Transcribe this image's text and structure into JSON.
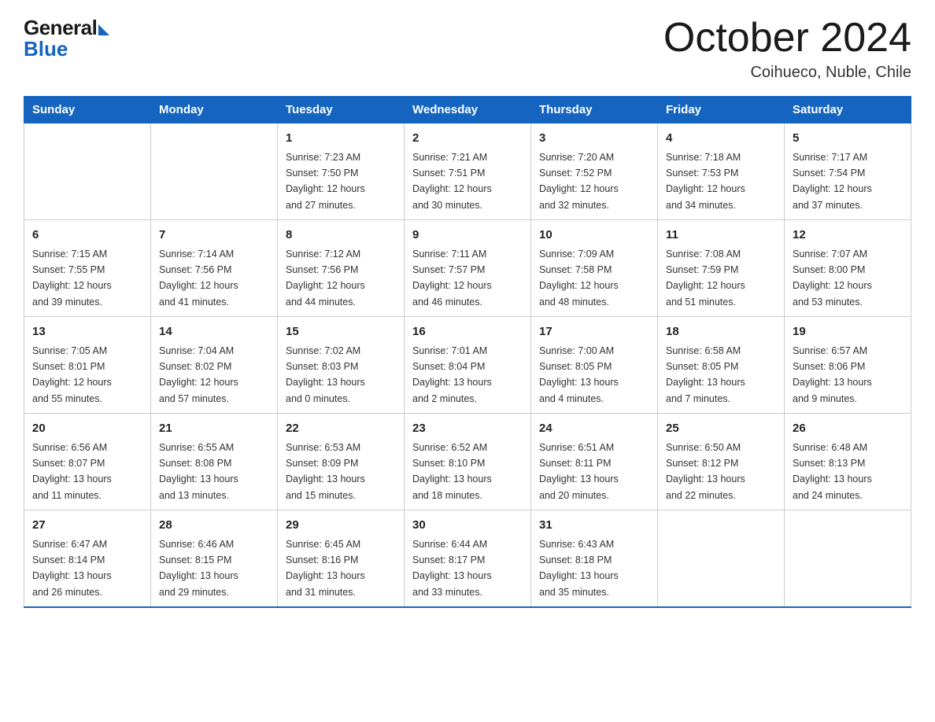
{
  "header": {
    "logo_general": "General",
    "logo_blue": "Blue",
    "month_title": "October 2024",
    "subtitle": "Coihueco, Nuble, Chile"
  },
  "days_of_week": [
    "Sunday",
    "Monday",
    "Tuesday",
    "Wednesday",
    "Thursday",
    "Friday",
    "Saturday"
  ],
  "weeks": [
    [
      {
        "day": "",
        "info": ""
      },
      {
        "day": "",
        "info": ""
      },
      {
        "day": "1",
        "info": "Sunrise: 7:23 AM\nSunset: 7:50 PM\nDaylight: 12 hours\nand 27 minutes."
      },
      {
        "day": "2",
        "info": "Sunrise: 7:21 AM\nSunset: 7:51 PM\nDaylight: 12 hours\nand 30 minutes."
      },
      {
        "day": "3",
        "info": "Sunrise: 7:20 AM\nSunset: 7:52 PM\nDaylight: 12 hours\nand 32 minutes."
      },
      {
        "day": "4",
        "info": "Sunrise: 7:18 AM\nSunset: 7:53 PM\nDaylight: 12 hours\nand 34 minutes."
      },
      {
        "day": "5",
        "info": "Sunrise: 7:17 AM\nSunset: 7:54 PM\nDaylight: 12 hours\nand 37 minutes."
      }
    ],
    [
      {
        "day": "6",
        "info": "Sunrise: 7:15 AM\nSunset: 7:55 PM\nDaylight: 12 hours\nand 39 minutes."
      },
      {
        "day": "7",
        "info": "Sunrise: 7:14 AM\nSunset: 7:56 PM\nDaylight: 12 hours\nand 41 minutes."
      },
      {
        "day": "8",
        "info": "Sunrise: 7:12 AM\nSunset: 7:56 PM\nDaylight: 12 hours\nand 44 minutes."
      },
      {
        "day": "9",
        "info": "Sunrise: 7:11 AM\nSunset: 7:57 PM\nDaylight: 12 hours\nand 46 minutes."
      },
      {
        "day": "10",
        "info": "Sunrise: 7:09 AM\nSunset: 7:58 PM\nDaylight: 12 hours\nand 48 minutes."
      },
      {
        "day": "11",
        "info": "Sunrise: 7:08 AM\nSunset: 7:59 PM\nDaylight: 12 hours\nand 51 minutes."
      },
      {
        "day": "12",
        "info": "Sunrise: 7:07 AM\nSunset: 8:00 PM\nDaylight: 12 hours\nand 53 minutes."
      }
    ],
    [
      {
        "day": "13",
        "info": "Sunrise: 7:05 AM\nSunset: 8:01 PM\nDaylight: 12 hours\nand 55 minutes."
      },
      {
        "day": "14",
        "info": "Sunrise: 7:04 AM\nSunset: 8:02 PM\nDaylight: 12 hours\nand 57 minutes."
      },
      {
        "day": "15",
        "info": "Sunrise: 7:02 AM\nSunset: 8:03 PM\nDaylight: 13 hours\nand 0 minutes."
      },
      {
        "day": "16",
        "info": "Sunrise: 7:01 AM\nSunset: 8:04 PM\nDaylight: 13 hours\nand 2 minutes."
      },
      {
        "day": "17",
        "info": "Sunrise: 7:00 AM\nSunset: 8:05 PM\nDaylight: 13 hours\nand 4 minutes."
      },
      {
        "day": "18",
        "info": "Sunrise: 6:58 AM\nSunset: 8:05 PM\nDaylight: 13 hours\nand 7 minutes."
      },
      {
        "day": "19",
        "info": "Sunrise: 6:57 AM\nSunset: 8:06 PM\nDaylight: 13 hours\nand 9 minutes."
      }
    ],
    [
      {
        "day": "20",
        "info": "Sunrise: 6:56 AM\nSunset: 8:07 PM\nDaylight: 13 hours\nand 11 minutes."
      },
      {
        "day": "21",
        "info": "Sunrise: 6:55 AM\nSunset: 8:08 PM\nDaylight: 13 hours\nand 13 minutes."
      },
      {
        "day": "22",
        "info": "Sunrise: 6:53 AM\nSunset: 8:09 PM\nDaylight: 13 hours\nand 15 minutes."
      },
      {
        "day": "23",
        "info": "Sunrise: 6:52 AM\nSunset: 8:10 PM\nDaylight: 13 hours\nand 18 minutes."
      },
      {
        "day": "24",
        "info": "Sunrise: 6:51 AM\nSunset: 8:11 PM\nDaylight: 13 hours\nand 20 minutes."
      },
      {
        "day": "25",
        "info": "Sunrise: 6:50 AM\nSunset: 8:12 PM\nDaylight: 13 hours\nand 22 minutes."
      },
      {
        "day": "26",
        "info": "Sunrise: 6:48 AM\nSunset: 8:13 PM\nDaylight: 13 hours\nand 24 minutes."
      }
    ],
    [
      {
        "day": "27",
        "info": "Sunrise: 6:47 AM\nSunset: 8:14 PM\nDaylight: 13 hours\nand 26 minutes."
      },
      {
        "day": "28",
        "info": "Sunrise: 6:46 AM\nSunset: 8:15 PM\nDaylight: 13 hours\nand 29 minutes."
      },
      {
        "day": "29",
        "info": "Sunrise: 6:45 AM\nSunset: 8:16 PM\nDaylight: 13 hours\nand 31 minutes."
      },
      {
        "day": "30",
        "info": "Sunrise: 6:44 AM\nSunset: 8:17 PM\nDaylight: 13 hours\nand 33 minutes."
      },
      {
        "day": "31",
        "info": "Sunrise: 6:43 AM\nSunset: 8:18 PM\nDaylight: 13 hours\nand 35 minutes."
      },
      {
        "day": "",
        "info": ""
      },
      {
        "day": "",
        "info": ""
      }
    ]
  ]
}
